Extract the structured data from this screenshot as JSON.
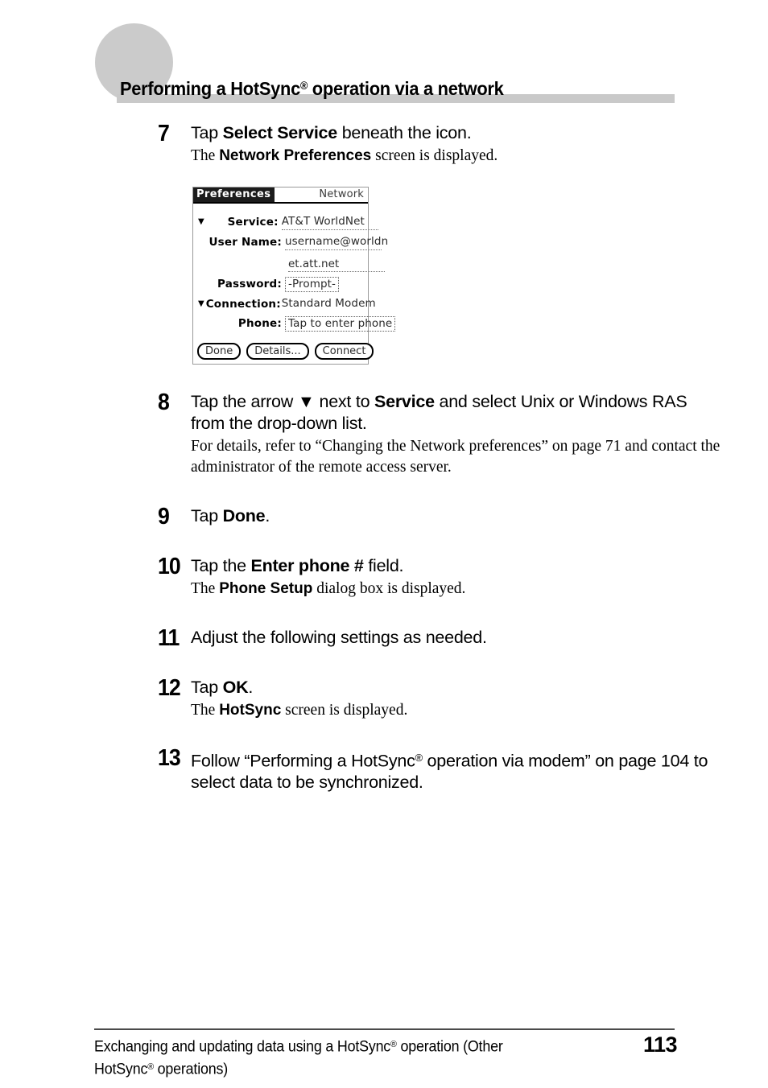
{
  "header": {
    "title_prefix": "Performing a HotSync",
    "title_sup": "®",
    "title_suffix": " operation via a network"
  },
  "steps": [
    {
      "number": "7",
      "main_parts": [
        {
          "text": "Tap ",
          "bold": false
        },
        {
          "text": "Select Service",
          "bold": true
        },
        {
          "text": " beneath the icon.",
          "bold": false
        }
      ],
      "sub_parts": [
        {
          "text": "The ",
          "bold": false
        },
        {
          "text": "Network Preferences",
          "bold": true
        },
        {
          "text": " screen is displayed.",
          "bold": false
        }
      ]
    },
    {
      "number": "8",
      "main_parts": [
        {
          "text": "Tap the arrow ▼ next to ",
          "bold": false
        },
        {
          "text": "Service",
          "bold": true
        },
        {
          "text": " and select Unix or Windows RAS from the drop-down list.",
          "bold": false
        }
      ],
      "sub_parts": [
        {
          "text": "For details, refer to “Changing the Network preferences” on page 71 and contact the administrator of the remote access server.",
          "bold": false
        }
      ]
    },
    {
      "number": "9",
      "main_parts": [
        {
          "text": "Tap ",
          "bold": false
        },
        {
          "text": "Done",
          "bold": true
        },
        {
          "text": ".",
          "bold": false
        }
      ],
      "sub_parts": []
    },
    {
      "number": "10",
      "main_parts": [
        {
          "text": "Tap the ",
          "bold": false
        },
        {
          "text": "Enter phone #",
          "bold": true
        },
        {
          "text": " field.",
          "bold": false
        }
      ],
      "sub_parts": [
        {
          "text": "The ",
          "bold": false
        },
        {
          "text": "Phone Setup",
          "bold": true
        },
        {
          "text": " dialog box is displayed.",
          "bold": false
        }
      ]
    },
    {
      "number": "11",
      "main_parts": [
        {
          "text": "Adjust the following settings as needed.",
          "bold": false
        }
      ],
      "sub_parts": []
    },
    {
      "number": "12",
      "main_parts": [
        {
          "text": "Tap ",
          "bold": false
        },
        {
          "text": "OK",
          "bold": true
        },
        {
          "text": ".",
          "bold": false
        }
      ],
      "sub_parts": [
        {
          "text": "The ",
          "bold": false
        },
        {
          "text": "HotSync",
          "bold": true
        },
        {
          "text": " screen is displayed.",
          "bold": false
        }
      ]
    },
    {
      "number": "13",
      "main_parts": [
        {
          "text": "Follow “Performing a HotSync",
          "bold": false
        },
        {
          "text": "®",
          "bold": false,
          "sup": true
        },
        {
          "text": " operation via modem” on page 104 to select data to be synchronized.",
          "bold": false
        }
      ],
      "sub_parts": []
    }
  ],
  "palm_screen": {
    "app_title": "Preferences",
    "screen_title": "Network",
    "fields": [
      {
        "label": "Service:",
        "value": "AT&T WorldNet",
        "arrow": true,
        "style": "underdot"
      },
      {
        "label": "User Name:",
        "value": "username@worldn",
        "value_line2": "et.att.net",
        "arrow": false,
        "style": "underdot"
      },
      {
        "label": "Password:",
        "value": "-Prompt-",
        "arrow": false,
        "style": "boxdot"
      },
      {
        "label": "Connection:",
        "value": "Standard Modem",
        "arrow": true,
        "style": "plain"
      },
      {
        "label": "Phone:",
        "value": "Tap to enter phone",
        "arrow": false,
        "style": "boxdot"
      }
    ],
    "buttons": [
      "Done",
      "Details...",
      "Connect"
    ]
  },
  "footer": {
    "line1_prefix": "Exchanging and updating data using a HotSync",
    "line1_sup": "®",
    "line1_suffix": " operation (Other",
    "line2_prefix": "HotSync",
    "line2_sup": "®",
    "line2_suffix": " operations)",
    "page_number": "113"
  }
}
